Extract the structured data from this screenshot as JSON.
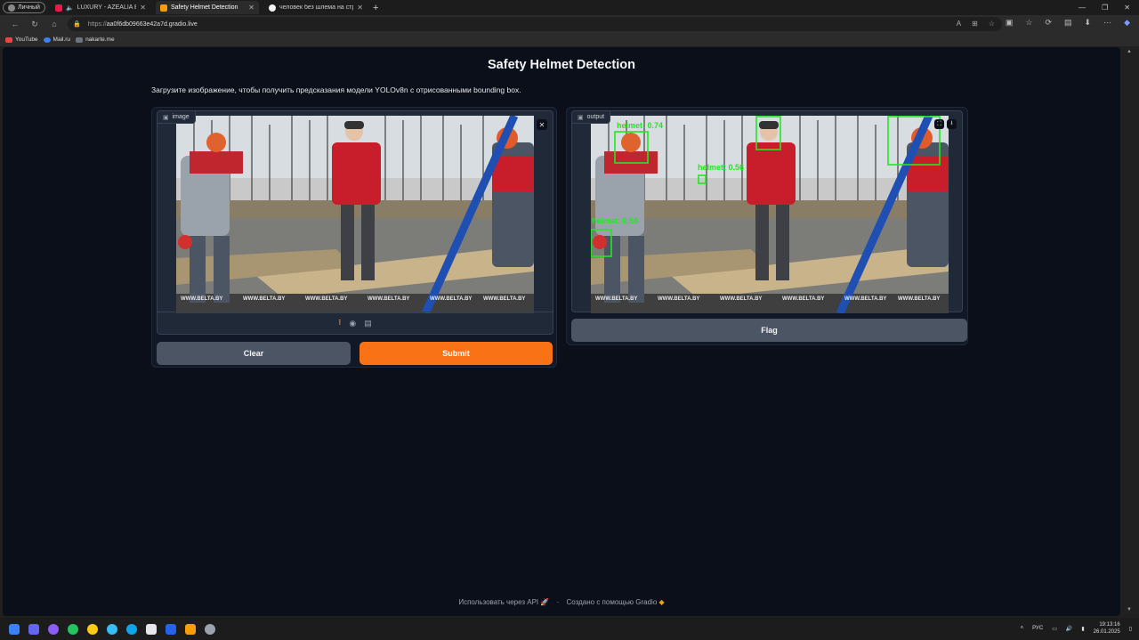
{
  "browser": {
    "profile_label": "Личный",
    "tabs": [
      {
        "title": "LUXURY - AZEALIA BANKS (",
        "favicon_color": "#e11d48",
        "active": false
      },
      {
        "title": "Safety Helmet Detection",
        "favicon_color": "#f59e0b",
        "active": true
      },
      {
        "title": "человек без шлема на стройке",
        "favicon_color": "#f3f4f6",
        "active": false
      }
    ],
    "url_proto": "https://",
    "url_host": "aa0f6db09663e42a7d.gradio.live",
    "bookmarks": [
      {
        "label": "YouTube",
        "color": "#ef4444"
      },
      {
        "label": "Mail.ru",
        "color": "#3b82f6"
      },
      {
        "label": "nakarte.me",
        "color": "#6b7280"
      }
    ]
  },
  "app": {
    "title": "Safety Helmet Detection",
    "description": "Загрузите изображение, чтобы получить предсказания модели YOLOv8n с отрисованными bounding box.",
    "input_label": "image",
    "output_label": "output",
    "clear_label": "Clear",
    "submit_label": "Submit",
    "flag_label": "Flag",
    "detections": [
      {
        "label": "helmet: 0.74"
      },
      {
        "label": "helmet: 0.56"
      },
      {
        "label": "helmet: 0.58"
      }
    ],
    "watermark": "WWW.BELTA.BY"
  },
  "footer": {
    "api_label": "Использовать через API",
    "built_label": "Создано с помощью Gradio"
  },
  "taskbar": {
    "lang": "РУС",
    "time": "19:13:16",
    "date": "26.01.2025"
  }
}
